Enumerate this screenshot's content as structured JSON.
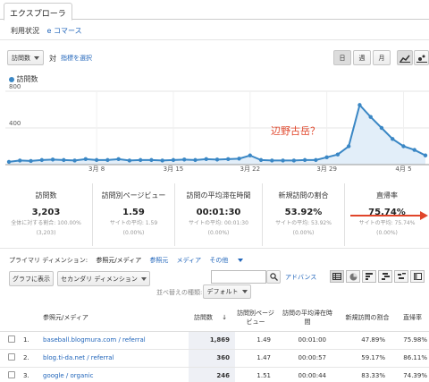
{
  "tabs": {
    "explorer": "エクスプローラ"
  },
  "subnav": {
    "usage": "利用状況",
    "ecommerce": "e コマース"
  },
  "metric_selector": {
    "primary": "訪問数",
    "vs": "対",
    "select_metric": "指標を選択"
  },
  "period_buttons": [
    "日",
    "週",
    "月"
  ],
  "legend": {
    "series": "訪問数"
  },
  "annotation": "辺野古岳？",
  "chart_data": {
    "type": "area",
    "x": [
      "2014-02-28",
      "2014-03-01",
      "2014-03-02",
      "2014-03-03",
      "2014-03-04",
      "2014-03-05",
      "2014-03-06",
      "2014-03-07",
      "2014-03-08",
      "2014-03-09",
      "2014-03-10",
      "2014-03-11",
      "2014-03-12",
      "2014-03-13",
      "2014-03-14",
      "2014-03-15",
      "2014-03-16",
      "2014-03-17",
      "2014-03-18",
      "2014-03-19",
      "2014-03-20",
      "2014-03-21",
      "2014-03-22",
      "2014-03-23",
      "2014-03-24",
      "2014-03-25",
      "2014-03-26",
      "2014-03-27",
      "2014-03-28",
      "2014-03-29",
      "2014-03-30",
      "2014-03-31",
      "2014-04-01",
      "2014-04-02",
      "2014-04-03",
      "2014-04-04",
      "2014-04-05",
      "2014-04-06",
      "2014-04-07"
    ],
    "series": [
      {
        "name": "訪問数",
        "values": [
          30,
          45,
          40,
          50,
          55,
          50,
          45,
          60,
          50,
          50,
          60,
          45,
          50,
          50,
          45,
          50,
          55,
          50,
          60,
          55,
          60,
          65,
          100,
          50,
          45,
          45,
          45,
          50,
          50,
          80,
          110,
          200,
          650,
          520,
          400,
          280,
          200,
          160,
          100
        ]
      }
    ],
    "x_tick_labels": [
      "3月 8",
      "3月 15",
      "3月 22",
      "3月 29",
      "4月 5"
    ],
    "y_tick_labels": [
      "800",
      "400"
    ],
    "ylim": [
      0,
      800
    ],
    "grid": true,
    "color": "#3a87c5"
  },
  "stats": [
    {
      "label": "訪問数",
      "value": "3,203",
      "sub1": "全体に対する割合: 100.00%",
      "sub2": "(3,203)"
    },
    {
      "label": "訪問別ページビュー",
      "value": "1.59",
      "sub1": "サイトの平均: 1.59",
      "sub2": "(0.00%)"
    },
    {
      "label": "訪問の平均滞在時間",
      "value": "00:01:30",
      "sub1": "サイトの平均: 00:01:30",
      "sub2": "(0.00%)"
    },
    {
      "label": "新規訪問の割合",
      "value": "53.92%",
      "sub1": "サイトの平均: 53.92%",
      "sub2": "(0.00%)"
    },
    {
      "label": "直帰率",
      "value": "75.74%",
      "sub1": "サイトの平均: 75.74%",
      "sub2": "(0.00%)"
    }
  ],
  "dimensions": {
    "label": "プライマリ ディメンション:",
    "current": "参照元/メディア",
    "source": "参照元",
    "medium": "メディア",
    "other": "その他"
  },
  "toolbar": {
    "plot": "グラフに表示",
    "secondary": "セカンダリ ディメンション",
    "sort_label": "並べ替えの種類:",
    "sort_value": "デフォルト",
    "advanced": "アドバンス"
  },
  "table": {
    "headers": {
      "source_medium": "参照元/メディア",
      "visits": "訪問数",
      "pages_per_visit": "訪問別ページビュー",
      "avg_duration": "訪問の平均滞在時間",
      "new_visits": "新規訪問の割合",
      "bounce": "直帰率"
    },
    "rows": [
      {
        "idx": "1.",
        "name": "baseball.blogmura.com / referral",
        "visits": "1,869",
        "ppv": "1.49",
        "dur": "00:01:00",
        "new": "47.89%",
        "bounce": "75.98%"
      },
      {
        "idx": "2.",
        "name": "blog.ti-da.net / referral",
        "visits": "360",
        "ppv": "1.47",
        "dur": "00:00:57",
        "new": "59.17%",
        "bounce": "86.11%"
      },
      {
        "idx": "3.",
        "name": "google / organic",
        "visits": "246",
        "ppv": "1.51",
        "dur": "00:00:44",
        "new": "83.33%",
        "bounce": "74.39%"
      }
    ]
  }
}
